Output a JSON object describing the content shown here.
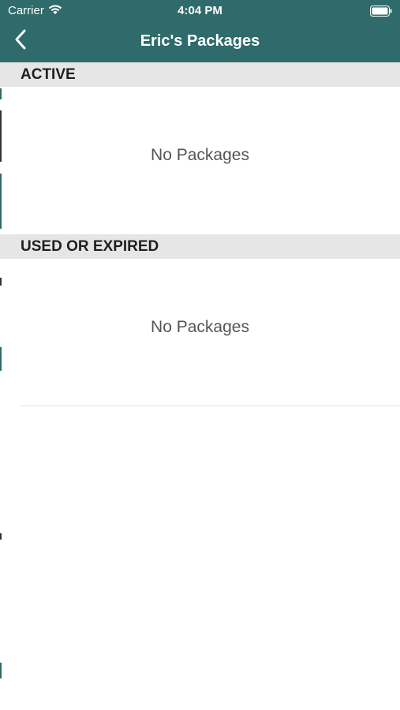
{
  "status_bar": {
    "carrier": "Carrier",
    "time": "4:04 PM",
    "icons": [
      "wifi-icon",
      "battery-icon"
    ]
  },
  "nav": {
    "title": "Eric's Packages",
    "back_icon": "chevron-left-icon"
  },
  "sections": [
    {
      "header": "ACTIVE",
      "empty_message": "No Packages"
    },
    {
      "header": "USED OR EXPIRED",
      "empty_message": "No Packages"
    }
  ],
  "colors": {
    "nav_background": "#2e6b6a",
    "section_header_background": "#e6e6e6",
    "text_secondary": "#555555"
  }
}
